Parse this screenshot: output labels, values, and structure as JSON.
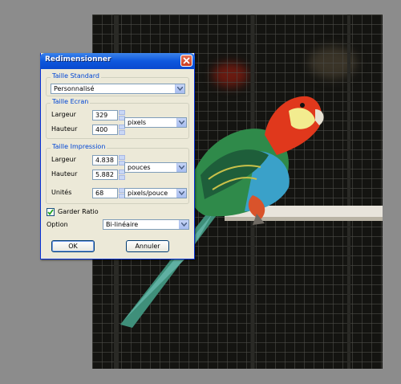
{
  "dialog": {
    "title": "Redimensionner",
    "standard": {
      "legend": "Taille Standard",
      "preset": "Personnalisé"
    },
    "screen": {
      "legend": "Taille Ecran",
      "width_label": "Largeur",
      "width_value": "329",
      "height_label": "Hauteur",
      "height_value": "400",
      "unit": "pixels"
    },
    "print": {
      "legend": "Taille Impression",
      "width_label": "Largeur",
      "width_value": "4.838",
      "height_label": "Hauteur",
      "height_value": "5.882",
      "size_unit": "pouces",
      "units_label": "Unités",
      "units_value": "68",
      "resolution_unit": "pixels/pouce"
    },
    "keep_ratio": {
      "label": "Garder Ratio",
      "checked": true
    },
    "option": {
      "label": "Option",
      "value": "Bi-linéaire"
    },
    "ok_label": "OK",
    "cancel_label": "Annuler"
  },
  "colors": {
    "titlebar": "#0e58de",
    "group_legend": "#0046d5",
    "window_bg": "#ece9d8"
  }
}
